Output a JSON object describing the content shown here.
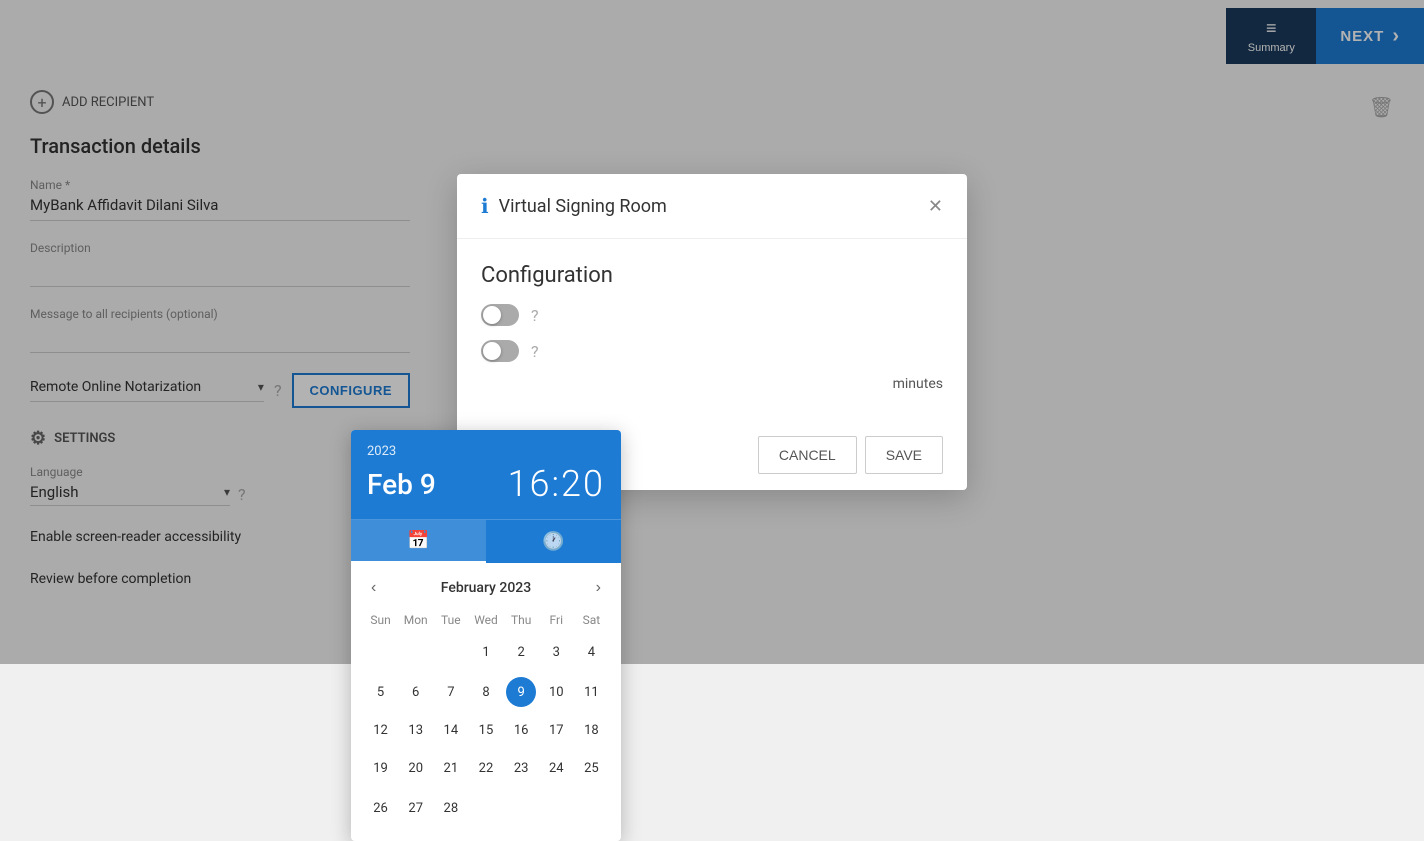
{
  "topBar": {
    "summaryLabel": "Summary",
    "nextLabel": "NEXT"
  },
  "page": {
    "addRecipientLabel": "ADD RECIPIENT",
    "transactionDetailsTitle": "Transaction details",
    "nameLabel": "Name *",
    "nameValue": "MyBank Affidavit Dilani Silva",
    "descriptionLabel": "Description",
    "descriptionValue": "",
    "messageLabel": "Message to all recipients (optional)",
    "messageValue": "",
    "notarizationLabel": "Remote Online Notarization",
    "configureLabel": "CONFIGURE",
    "settingsLabel": "SETTINGS",
    "languageLabel": "Language",
    "languageValue": "English",
    "accessibilityLabel": "Enable screen-reader accessibility",
    "reviewLabel": "Review before completion"
  },
  "modal": {
    "title": "Virtual Signing Room",
    "configTitle": "Configuration",
    "minutesLabel": "minutes",
    "cancelLabel": "CANCEL",
    "saveLabel": "SAVE",
    "toggle1Label": "",
    "toggle2Label": ""
  },
  "datePicker": {
    "year": "2023",
    "dateDisplay": "Feb 9",
    "timeDisplay": "16:20",
    "monthLabel": "February 2023",
    "weekdays": [
      "Sun",
      "Mon",
      "Tue",
      "Wed",
      "Thu",
      "Fri",
      "Sat"
    ],
    "weeks": [
      [
        "",
        "",
        "",
        "1",
        "2",
        "3",
        "4"
      ],
      [
        "5",
        "6",
        "7",
        "8",
        "9",
        "10",
        "11"
      ],
      [
        "12",
        "13",
        "14",
        "15",
        "16",
        "17",
        "18"
      ],
      [
        "19",
        "20",
        "21",
        "22",
        "23",
        "24",
        "25"
      ],
      [
        "26",
        "27",
        "28",
        "",
        "",
        "",
        ""
      ]
    ],
    "selectedDay": "9"
  },
  "icons": {
    "addRecipient": "⊕",
    "close": "✕",
    "info": "ℹ",
    "gear": "⚙",
    "chevronDown": "▾",
    "chevronLeft": "‹",
    "chevronRight": "›",
    "calendar": "📅",
    "clock": "🕐",
    "summary": "≡",
    "next": "›",
    "delete": "🗑",
    "help": "?"
  }
}
